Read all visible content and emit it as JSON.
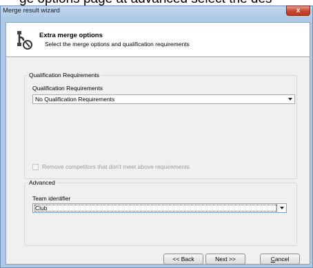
{
  "caption": "ge options page at advanced select the des",
  "window": {
    "title": "Merge result wizard",
    "close_glyph": "x"
  },
  "header": {
    "icon": "merge-wizard-icon",
    "title": "Extra merge options",
    "subtitle": "Select the merge options and qualification requirements"
  },
  "qualification_group": {
    "title": "Qualification Requirements",
    "field_label": "Qualification Requirements",
    "selected": "No Qualification Requirements",
    "checkbox_label": "Remove competitors that don't meet above requirements",
    "checkbox_checked": false,
    "checkbox_enabled": false
  },
  "advanced_group": {
    "title": "Advanced",
    "field_label": "Team identifier",
    "selected": "Club"
  },
  "buttons": {
    "back": "<< Back",
    "next": "Next >>",
    "cancel_first": "C",
    "cancel_rest": "ancel"
  }
}
